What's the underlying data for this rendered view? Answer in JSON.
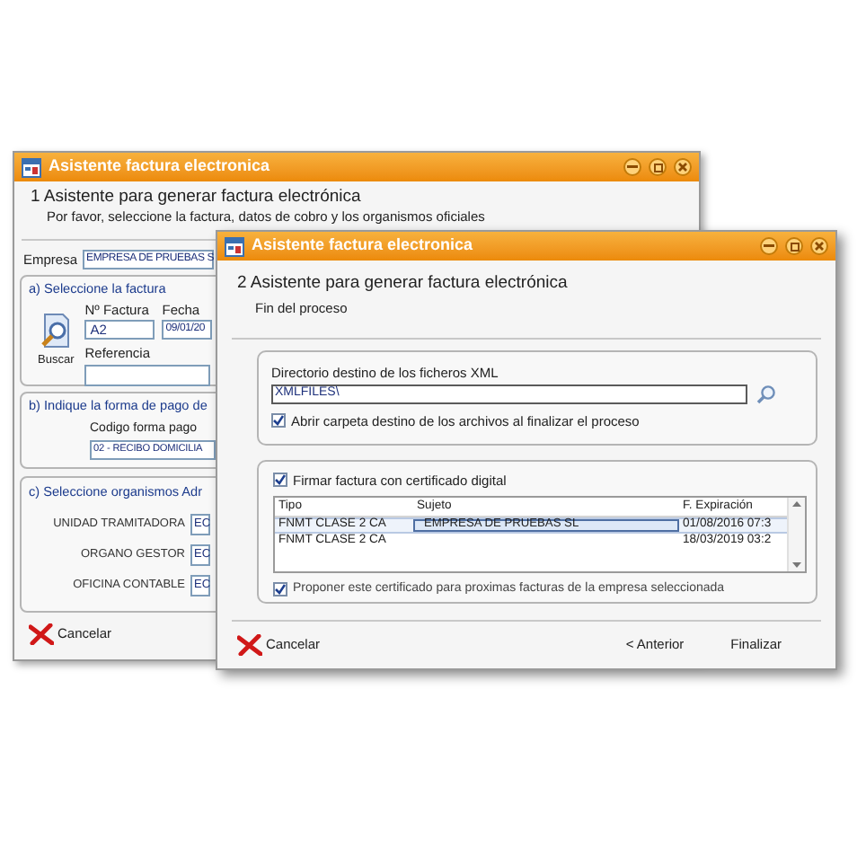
{
  "back_window": {
    "title": "Asistente factura electronica",
    "heading": "1 Asistente para generar factura electrónica",
    "subtitle": "Por favor, seleccione la factura, datos de cobro y los organismos oficiales",
    "empresa": {
      "label": "Empresa",
      "value": "EMPRESA DE PRUEBAS S"
    },
    "section_a": {
      "title": "a) Seleccione la factura",
      "factura_label": "Nº Factura",
      "factura_value": "A2",
      "fecha_label": "Fecha",
      "fecha_value": "09/01/20",
      "referencia_label": "Referencia",
      "search_button": "Buscar"
    },
    "section_b": {
      "title": "b) Indique la forma de pago de",
      "codigo_label": "Codigo forma pago",
      "codigo_value": "02 - RECIBO DOMICILIA"
    },
    "section_c": {
      "title": "c) Seleccione organismos Adr",
      "rows": [
        {
          "label": "UNIDAD TRAMITADORA",
          "value": "EC"
        },
        {
          "label": "ORGANO GESTOR",
          "value": "EC"
        },
        {
          "label": "OFICINA CONTABLE",
          "value": "EC"
        }
      ]
    },
    "cancel_button": "Cancelar"
  },
  "front_window": {
    "title": "Asistente factura electronica",
    "heading": "2 Asistente para generar factura electrónica",
    "subtitle": "Fin del proceso",
    "directory": {
      "label": "Directorio destino de los ficheros XML",
      "value": "XMLFILES\\"
    },
    "open_folder": {
      "label": "Abrir carpeta destino de los archivos al finalizar el proceso",
      "checked": true
    },
    "sign": {
      "label": "Firmar factura con certificado digital",
      "checked": true
    },
    "table": {
      "columns": [
        "Tipo",
        "Sujeto",
        "F. Expiración"
      ],
      "rows": [
        {
          "cells": [
            "FNMT CLASE 2 CA",
            "EMPRESA DE PRUEBAS SL",
            "01/08/2016 07:3"
          ],
          "selected": true
        },
        {
          "cells": [
            "FNMT CLASE 2 CA",
            "",
            "18/03/2019 03:2"
          ],
          "selected": false
        }
      ]
    },
    "propose": {
      "label": "Proponer este certificado para proximas facturas de la empresa seleccionada",
      "checked": true
    },
    "buttons": {
      "cancel": "Cancelar",
      "back": "< Anterior",
      "finish": "Finalizar"
    }
  }
}
